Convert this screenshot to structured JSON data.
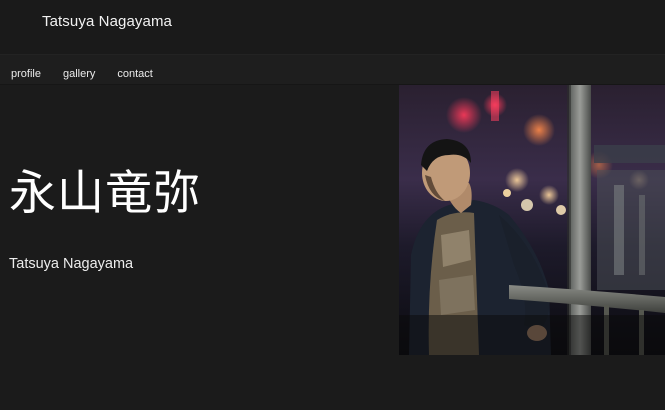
{
  "header": {
    "site_title": "Tatsuya Nagayama"
  },
  "nav": {
    "items": [
      {
        "label": "profile"
      },
      {
        "label": "gallery"
      },
      {
        "label": "contact"
      }
    ]
  },
  "hero": {
    "name_jp": "永山竜弥",
    "name_en": "Tatsuya Nagayama",
    "photo": "portrait-photo"
  },
  "colors": {
    "background": "#1b1b1b",
    "text": "#ffffff"
  }
}
